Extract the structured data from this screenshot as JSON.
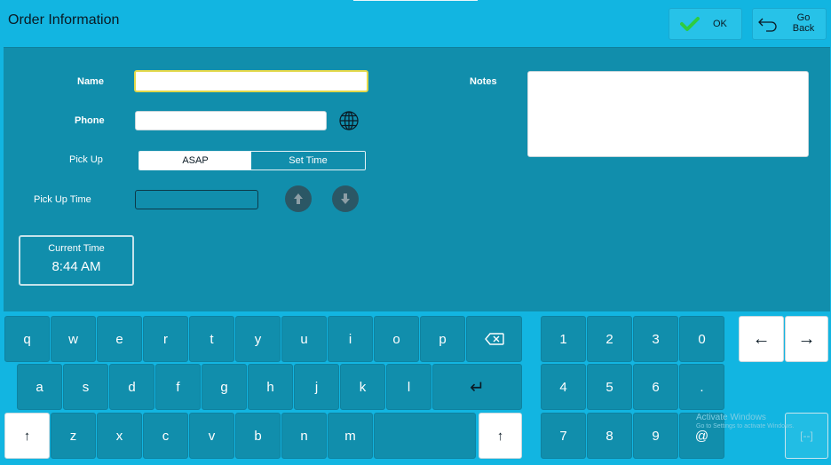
{
  "header": {
    "title": "Order Information",
    "ok_label": "OK",
    "back_label": "Go Back"
  },
  "form": {
    "name_label": "Name",
    "name_value": "",
    "phone_label": "Phone",
    "phone_value": "",
    "pickup_label": "Pick Up",
    "pickup_options": [
      "ASAP",
      "Set Time"
    ],
    "pickup_selected": "ASAP",
    "pickup_time_label": "Pick Up Time",
    "pickup_time_value": "",
    "notes_label": "Notes",
    "notes_value": ""
  },
  "current_time": {
    "label": "Current Time",
    "value": "8:44 AM"
  },
  "keyboard": {
    "row1": [
      "q",
      "w",
      "e",
      "r",
      "t",
      "y",
      "u",
      "i",
      "o",
      "p"
    ],
    "row2": [
      "a",
      "s",
      "d",
      "f",
      "g",
      "h",
      "j",
      "k",
      "l"
    ],
    "row3": [
      "z",
      "x",
      "c",
      "v",
      "b",
      "n",
      "m"
    ],
    "numpad": [
      "1",
      "2",
      "3",
      "0",
      "4",
      "5",
      "6",
      ".",
      "7",
      "8",
      "9",
      "@"
    ],
    "shift_label": "↑",
    "enter_label": "↵",
    "arrow_left": "←",
    "arrow_right": "→",
    "collapse_label": "[--]"
  },
  "watermark": {
    "line1": "Activate Windows",
    "line2": "Go to Settings to activate Windows."
  },
  "icons": [
    "check-icon",
    "back-arrow-icon",
    "globe-icon",
    "arrow-up-icon",
    "arrow-down-icon",
    "backspace-icon"
  ],
  "colors": {
    "background": "#12b5e1",
    "panel": "#118eac",
    "check": "#2ecc40",
    "active_border": "#e3d84b"
  }
}
